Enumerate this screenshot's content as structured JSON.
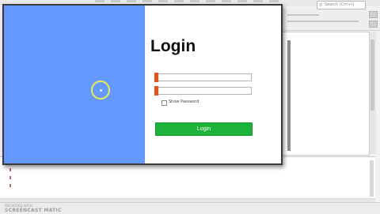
{
  "ide": {
    "search_placeholder": "Search (Ctrl+I)",
    "search_icon": "search-icon"
  },
  "login": {
    "title": "Login",
    "username_value": "",
    "password_value": "",
    "remember_label": "Show Password",
    "remember_checked": false,
    "login_button": "Login",
    "colors": {
      "left_panel": "#6699ff",
      "button": "#1db33a",
      "field_marker": "#e2541c",
      "cursor_highlight": "#e8ee4a"
    }
  },
  "watermark": {
    "line1": "RECORDED WITH",
    "line2": "SCREENCAST  MATIC"
  }
}
